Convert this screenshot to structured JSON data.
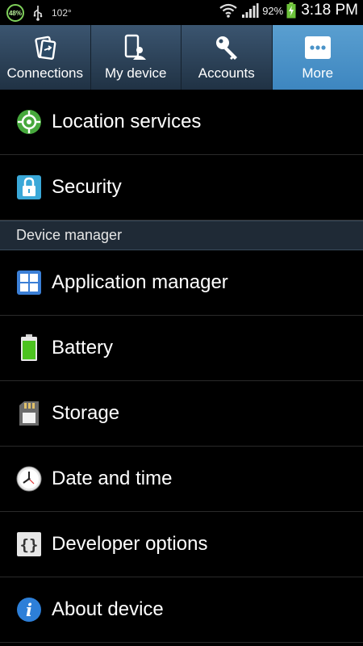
{
  "status_bar": {
    "battery_badge": "48%",
    "temperature": "102°",
    "battery_percent": "92%",
    "time": "3:18 PM"
  },
  "tabs": [
    {
      "label": "Connections",
      "icon": "connections-icon",
      "selected": false
    },
    {
      "label": "My device",
      "icon": "my-device-icon",
      "selected": false
    },
    {
      "label": "Accounts",
      "icon": "key-icon",
      "selected": false
    },
    {
      "label": "More",
      "icon": "more-icon",
      "selected": true
    }
  ],
  "list": {
    "top_items": [
      {
        "label": "Location services",
        "icon": "location-icon"
      },
      {
        "label": "Security",
        "icon": "lock-icon"
      }
    ],
    "section_header": "Device manager",
    "section_items": [
      {
        "label": "Application manager",
        "icon": "grid-icon"
      },
      {
        "label": "Battery",
        "icon": "battery-icon"
      },
      {
        "label": "Storage",
        "icon": "sd-card-icon"
      },
      {
        "label": "Date and time",
        "icon": "clock-icon"
      },
      {
        "label": "Developer options",
        "icon": "braces-icon"
      },
      {
        "label": "About device",
        "icon": "info-icon"
      }
    ]
  },
  "colors": {
    "selected_tab": "#4a93c8",
    "tab_bar": "#2b3f52",
    "section_header_bg": "#1f2a36"
  }
}
